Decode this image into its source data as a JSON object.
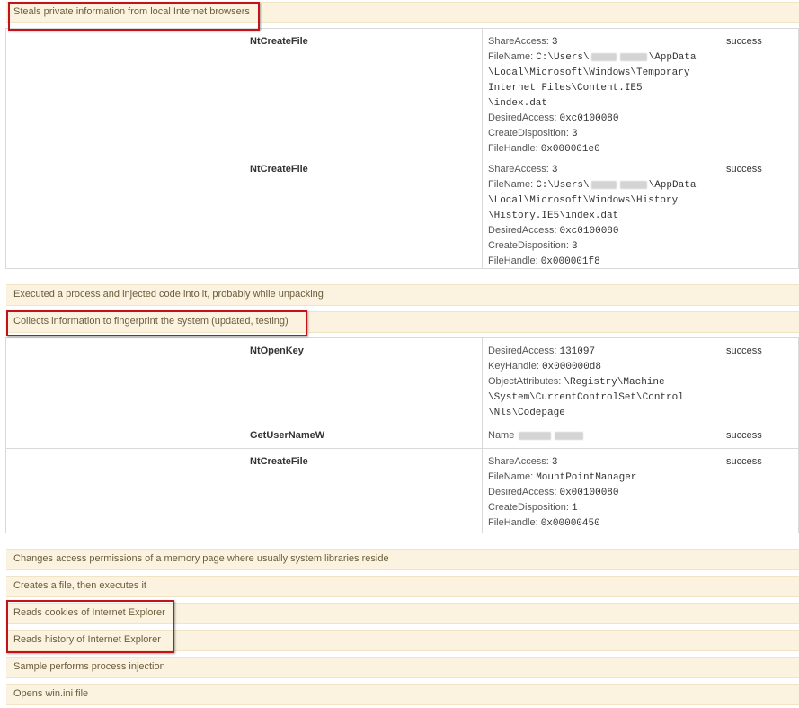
{
  "signatures": [
    "Steals private information from local Internet browsers",
    "Executed a process and injected code into it, probably while unpacking",
    "Collects information to fingerprint the system (updated, testing)",
    "Changes access permissions of a memory page where usually system libraries reside",
    "Creates a file, then executes it",
    "Reads cookies of Internet Explorer",
    "Reads history of Internet Explorer",
    "Sample performs process injection",
    "Opens win.ini file"
  ],
  "calls": {
    "c1": {
      "api": "NtCreateFile",
      "status": "success",
      "args": [
        {
          "k": "ShareAccess: ",
          "v": "3"
        },
        {
          "k": "FileName: ",
          "v": "C:\\Users\\"
        },
        {
          "k": "",
          "v": "\\AppData"
        },
        {
          "k": "",
          "v": "\\Local\\Microsoft\\Windows\\Temporary"
        },
        {
          "k": "",
          "v": "Internet Files\\Content.IE5"
        },
        {
          "k": "",
          "v": "\\index.dat"
        },
        {
          "k": "DesiredAccess: ",
          "v": "0xc0100080"
        },
        {
          "k": "CreateDisposition: ",
          "v": "3"
        },
        {
          "k": "FileHandle: ",
          "v": "0x000001e0"
        }
      ]
    },
    "c2": {
      "api": "NtCreateFile",
      "status": "success",
      "args": [
        {
          "k": "ShareAccess: ",
          "v": "3"
        },
        {
          "k": "FileName: ",
          "v": "C:\\Users\\"
        },
        {
          "k": "",
          "v": "\\AppData"
        },
        {
          "k": "",
          "v": "\\Local\\Microsoft\\Windows\\History"
        },
        {
          "k": "",
          "v": "\\History.IE5\\index.dat"
        },
        {
          "k": "DesiredAccess: ",
          "v": "0xc0100080"
        },
        {
          "k": "CreateDisposition: ",
          "v": "3"
        },
        {
          "k": "FileHandle: ",
          "v": "0x000001f8"
        }
      ]
    },
    "c3": {
      "api": "NtOpenKey",
      "status": "success",
      "args": [
        {
          "k": "DesiredAccess: ",
          "v": "131097"
        },
        {
          "k": "KeyHandle: ",
          "v": "0x000000d8"
        },
        {
          "k": "ObjectAttributes: ",
          "v": "\\Registry\\Machine"
        },
        {
          "k": "",
          "v": "\\System\\CurrentControlSet\\Control"
        },
        {
          "k": "",
          "v": "\\Nls\\Codepage"
        }
      ]
    },
    "c4": {
      "api": "GetUserNameW",
      "status": "success",
      "args": [
        {
          "k": "Name",
          "v": ""
        }
      ]
    },
    "c5": {
      "api": "NtCreateFile",
      "status": "success",
      "args": [
        {
          "k": "ShareAccess: ",
          "v": "3"
        },
        {
          "k": "FileName: ",
          "v": "MountPointManager"
        },
        {
          "k": "DesiredAccess: ",
          "v": "0x00100080"
        },
        {
          "k": "CreateDisposition: ",
          "v": "1"
        },
        {
          "k": "FileHandle: ",
          "v": "0x00000450"
        }
      ]
    }
  },
  "colors": {
    "highlight": "#c4121b",
    "signature_bg": "#fbf3df"
  }
}
